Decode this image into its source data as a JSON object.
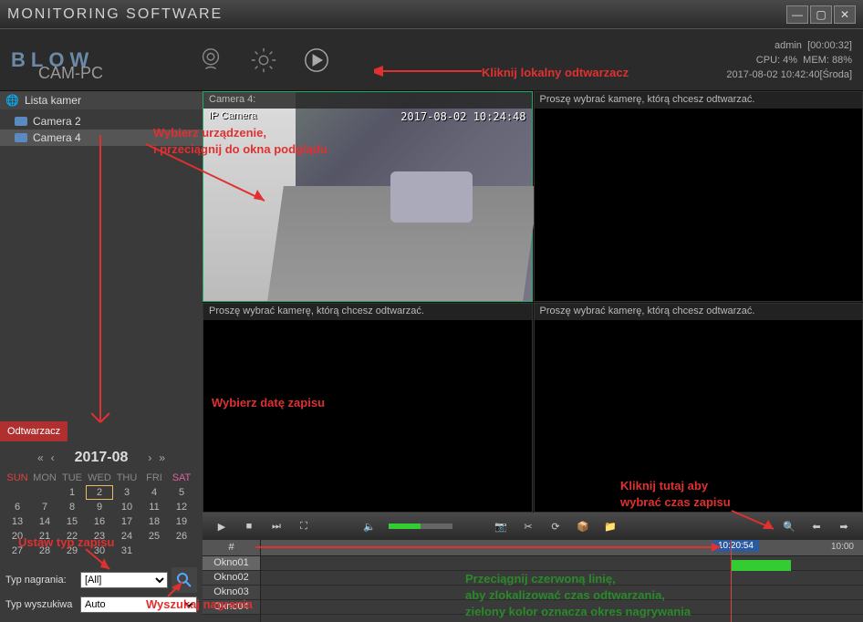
{
  "window": {
    "title": "MONITORING SOFTWARE"
  },
  "brand": {
    "name": "BLOW",
    "sub": "CAM-PC"
  },
  "status": {
    "user": "admin",
    "uptime": "[00:00:32]",
    "cpu_label": "CPU:",
    "cpu_val": "4%",
    "mem_label": "MEM:",
    "mem_val": "88%",
    "datetime": "2017-08-02 10:42:40[Środa]"
  },
  "sidebar": {
    "camlist_header": "Lista kamer",
    "cameras": [
      {
        "name": "Camera 2"
      },
      {
        "name": "Camera 4"
      }
    ],
    "tab_label": "Odtwarzacz"
  },
  "calendar": {
    "month": "2017-08",
    "dow": [
      "SUN",
      "MON",
      "TUE",
      "WED",
      "THU",
      "FRI",
      "SAT"
    ],
    "weeks": [
      [
        "",
        "",
        "1",
        "2",
        "3",
        "4",
        "5"
      ],
      [
        "6",
        "7",
        "8",
        "9",
        "10",
        "11",
        "12"
      ],
      [
        "13",
        "14",
        "15",
        "16",
        "17",
        "18",
        "19"
      ],
      [
        "20",
        "21",
        "22",
        "23",
        "24",
        "25",
        "26"
      ],
      [
        "27",
        "28",
        "29",
        "30",
        "31",
        "",
        ""
      ]
    ],
    "selected": "2"
  },
  "form": {
    "type_label": "Typ nagrania:",
    "type_value": "[All]",
    "search_label": "Typ wyszukiwa",
    "search_value": "Auto"
  },
  "panes": {
    "p1_title": "Camera 4:",
    "placeholder": "Proszę wybrać kamerę, którą chcesz odtwarzać.",
    "feed_osd": "IP Camera",
    "feed_time": "2017-08-02 10:24:48"
  },
  "timeline": {
    "col_header": "#",
    "rows": [
      "Okno01",
      "Okno02",
      "Okno03",
      "Okno04"
    ],
    "marker_time": "10:20:54",
    "tick_right": "10:00"
  },
  "annotations": {
    "a1": "Kliknij lokalny odtwarzacz",
    "a2a": "Wybierz urządzenie,",
    "a2b": "i przeciągnij do okna podglądu",
    "a3": "Wybierz datę zapisu",
    "a4": "Kliknij tutaj aby",
    "a4b": "wybrać czas zapisu",
    "a5": "Ustaw typ zapisu",
    "a6": "Wyszukaj nagrania",
    "a7a": "Przeciągnij czerwoną linię,",
    "a7b": "aby zlokalizować czas odtwarzania,",
    "a7c": "zielony kolor oznacza okres nagrywania"
  }
}
